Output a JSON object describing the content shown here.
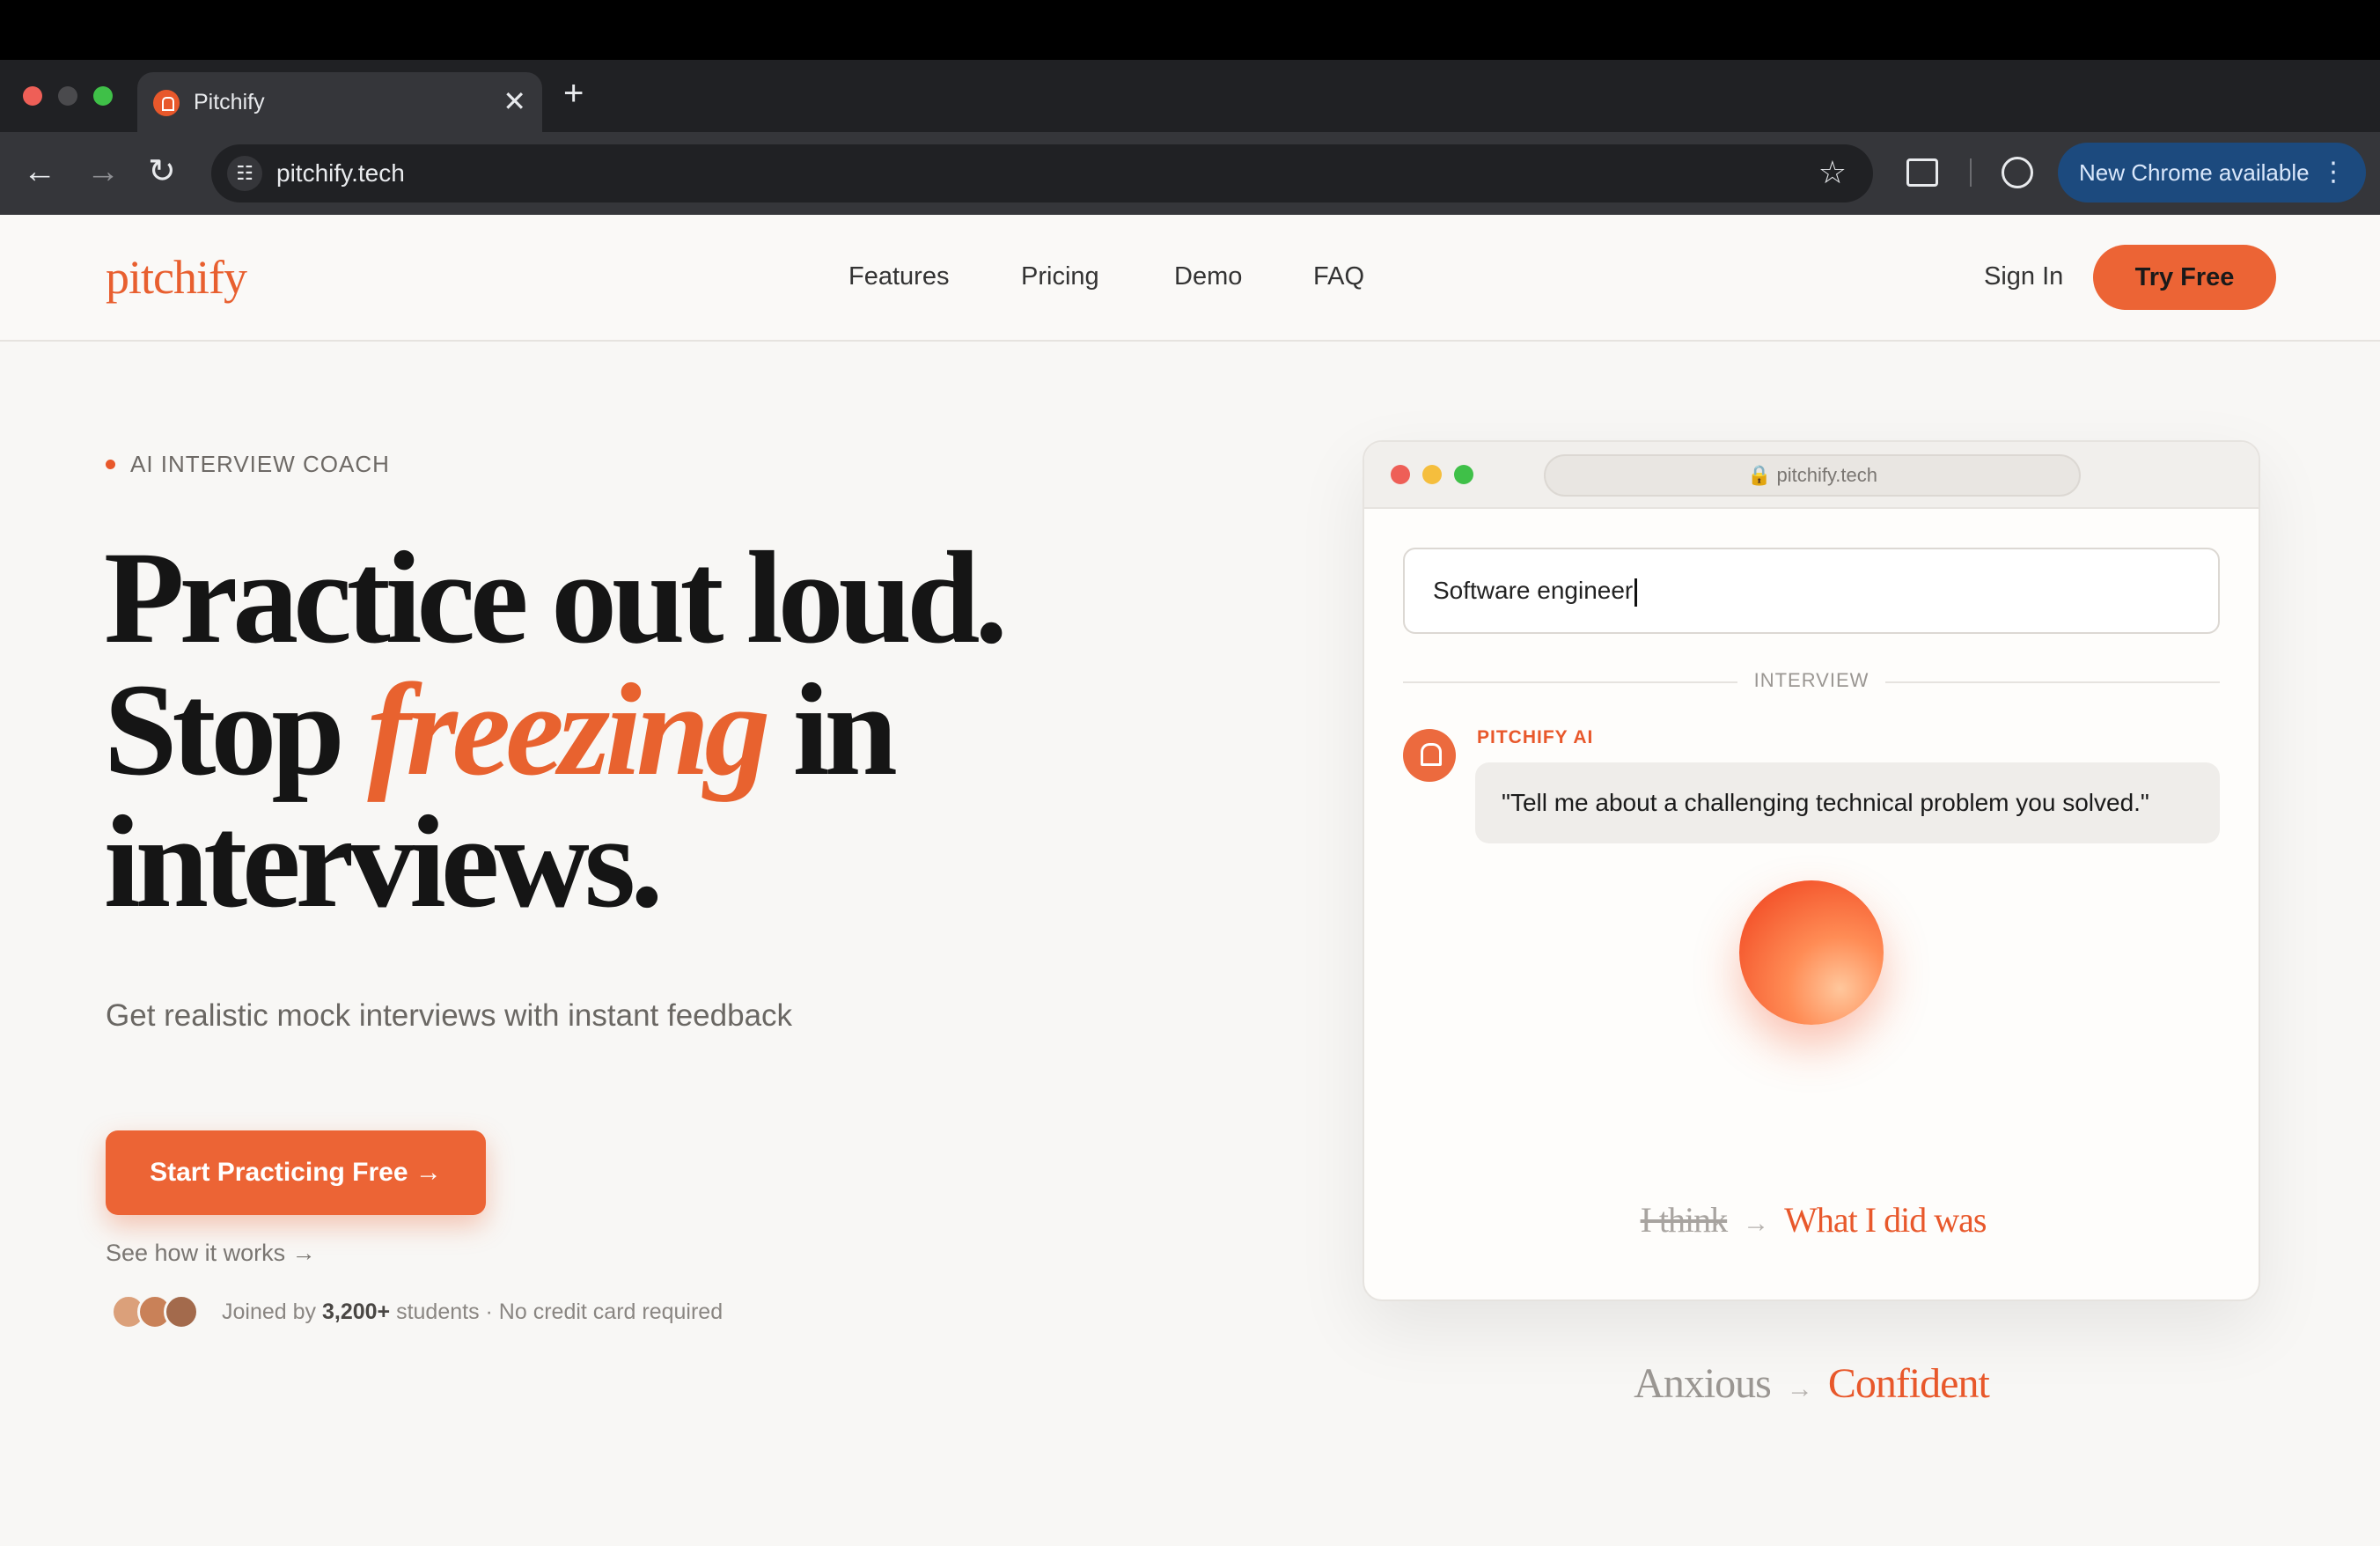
{
  "browser": {
    "tab_title": "Pitchify",
    "tab_close": "✕",
    "new_tab": "+",
    "url": "pitchify.tech",
    "back": "←",
    "forward": "→",
    "reload": "↻",
    "tune": "☷",
    "star": "☆",
    "update_label": "New Chrome available",
    "update_menu": "⋮"
  },
  "header": {
    "logo": "pitchify",
    "nav": [
      "Features",
      "Pricing",
      "Demo",
      "FAQ"
    ],
    "sign_in": "Sign In",
    "try_free": "Try Free"
  },
  "hero": {
    "eyebrow": "AI INTERVIEW COACH",
    "line1": "Practice out loud.",
    "line2_pre": "Stop ",
    "line2_accent": "freezing",
    "line2_post": " in",
    "line3": "interviews.",
    "subhead": "Get realistic mock interviews with instant feedback",
    "cta": "Start Practicing Free  →",
    "see_how": "See how it works →",
    "social_pre": "Joined by ",
    "social_count": "3,200+",
    "social_post": " students · No credit card required"
  },
  "mock": {
    "url": "🔒 pitchify.tech",
    "input_value": "Software engineer",
    "divider": "INTERVIEW",
    "ai_label": "PITCHIFY AI",
    "ai_message": "\"Tell me about a challenging technical problem you solved.\"",
    "reframe_from": "I think",
    "reframe_arrow": "→",
    "reframe_to": "What I did was"
  },
  "transform": {
    "from": "Anxious",
    "arrow": "→",
    "to": "Confident"
  },
  "colors": {
    "accent": "#ec6435",
    "page_bg": "#f8f7f5",
    "chrome_dark": "#202124"
  }
}
